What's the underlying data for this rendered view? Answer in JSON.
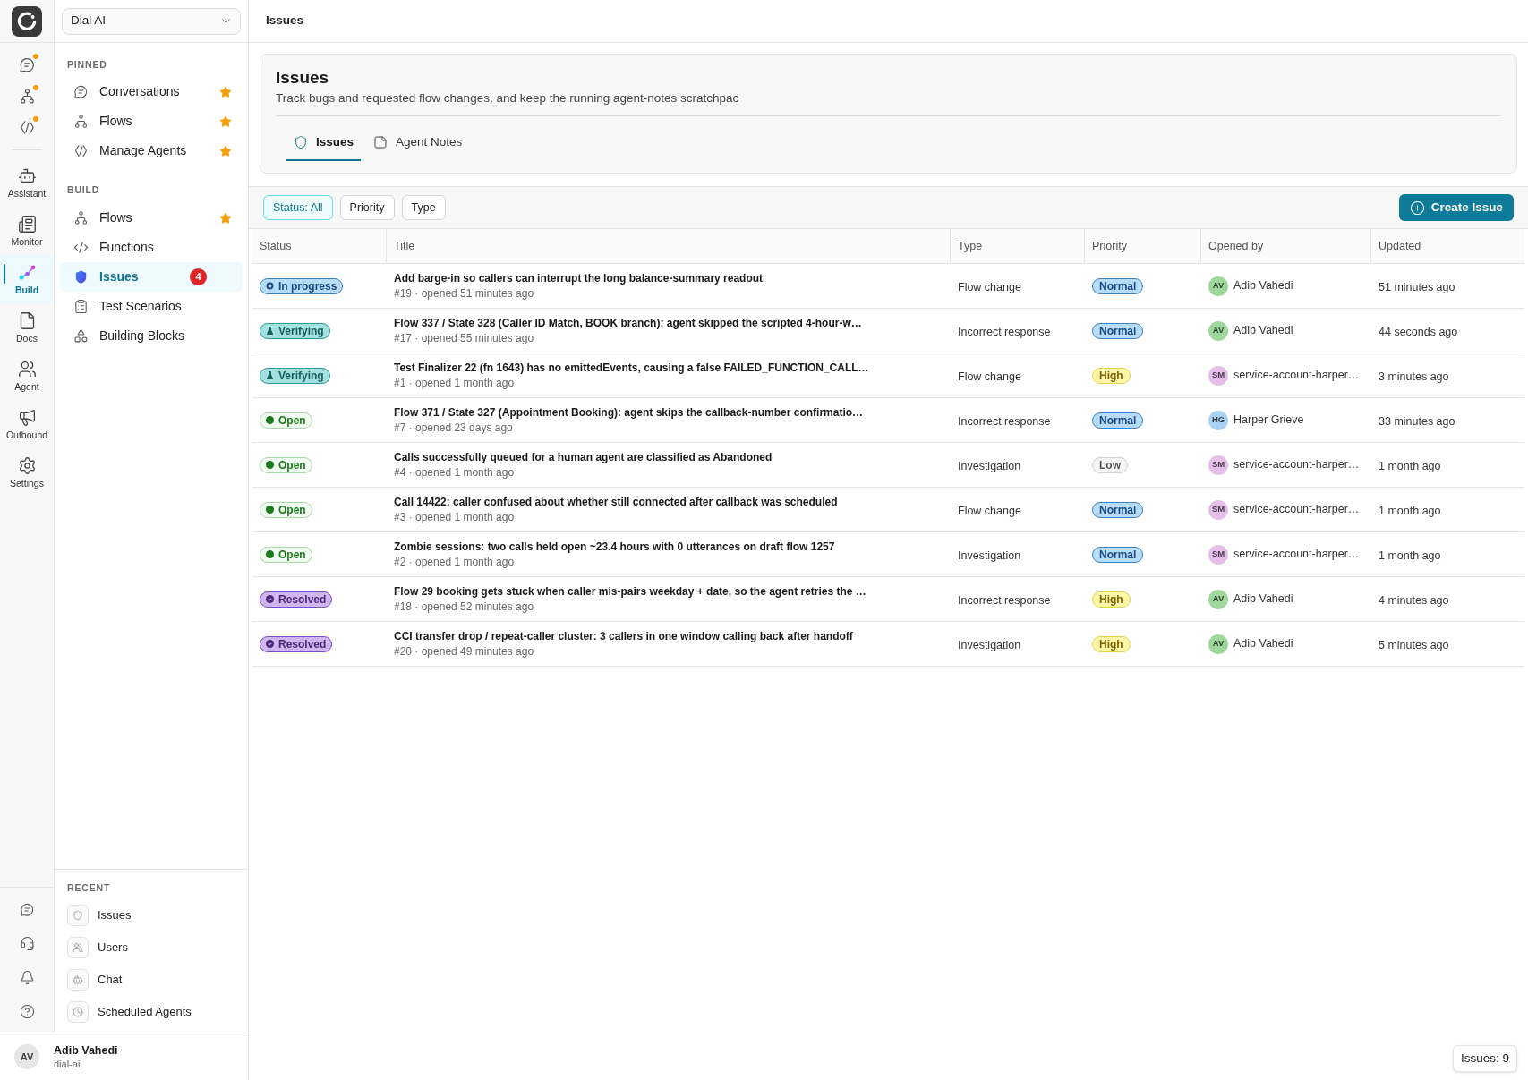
{
  "rail": {
    "top_items": [
      {
        "dot": true
      },
      {
        "dot": true
      },
      {
        "dot": true
      }
    ],
    "items": [
      {
        "label": "Assistant",
        "selected": false
      },
      {
        "label": "Monitor",
        "selected": false
      },
      {
        "label": "Build",
        "selected": true
      },
      {
        "label": "Docs",
        "selected": false
      },
      {
        "label": "Agent",
        "selected": false
      },
      {
        "label": "Outbound",
        "selected": false
      },
      {
        "label": "Settings",
        "selected": false
      }
    ]
  },
  "sidebar": {
    "workspace": "Dial AI",
    "pinned": {
      "heading": "PINNED",
      "items": [
        {
          "label": "Conversations",
          "starred": true
        },
        {
          "label": "Flows",
          "starred": true
        },
        {
          "label": "Manage Agents",
          "starred": true
        }
      ]
    },
    "build": {
      "heading": "BUILD",
      "items": [
        {
          "label": "Flows",
          "starred": true,
          "selected": false
        },
        {
          "label": "Functions",
          "starred": false,
          "selected": false
        },
        {
          "label": "Issues",
          "starred": false,
          "selected": true,
          "badge": "4"
        },
        {
          "label": "Test Scenarios",
          "starred": false,
          "selected": false
        },
        {
          "label": "Building Blocks",
          "starred": false,
          "selected": false
        }
      ]
    },
    "recent": {
      "heading": "RECENT",
      "items": [
        {
          "label": "Issues"
        },
        {
          "label": "Users"
        },
        {
          "label": "Chat"
        },
        {
          "label": "Scheduled Agents"
        }
      ]
    },
    "user": {
      "initials": "AV",
      "name": "Adib Vahedi",
      "org": "dial-ai"
    }
  },
  "topbar": {
    "title": "Issues"
  },
  "header": {
    "title": "Issues",
    "description": "Track bugs and requested flow changes, and keep the running agent-notes scratchpac",
    "tabs": [
      {
        "label": "Issues",
        "selected": true
      },
      {
        "label": "Agent Notes",
        "selected": false
      }
    ]
  },
  "toolbar": {
    "filters": [
      {
        "label": "Status: All",
        "active": true
      },
      {
        "label": "Priority",
        "active": false
      },
      {
        "label": "Type",
        "active": false
      }
    ],
    "create_button": "Create Issue"
  },
  "table": {
    "columns": [
      "Status",
      "Title",
      "Type",
      "Priority",
      "Opened by",
      "Updated"
    ],
    "rows": [
      {
        "status": {
          "label": "In progress",
          "kind": "progress"
        },
        "title": "Add barge-in so callers can interrupt the long balance-summary readout",
        "meta": "#19 · opened 51 minutes ago",
        "type": "Flow change",
        "priority": {
          "label": "Normal",
          "kind": "normal"
        },
        "opened_by": {
          "initials": "AV",
          "name": "Adib Vahedi",
          "color": "#9fd89c"
        },
        "updated": "51 minutes ago"
      },
      {
        "status": {
          "label": "Verifying",
          "kind": "verifying"
        },
        "title": "Flow 337 / State 328 (Caller ID Match, BOOK branch): agent skipped the scripted 4-hour-w…",
        "meta": "#17 · opened 55 minutes ago",
        "type": "Incorrect response",
        "priority": {
          "label": "Normal",
          "kind": "normal"
        },
        "opened_by": {
          "initials": "AV",
          "name": "Adib Vahedi",
          "color": "#9fd89c"
        },
        "updated": "44 seconds ago"
      },
      {
        "status": {
          "label": "Verifying",
          "kind": "verifying"
        },
        "title": "Test Finalizer 22 (fn 1643) has no emittedEvents, causing a false FAILED_FUNCTION_CALL…",
        "meta": "#1 · opened 1 month ago",
        "type": "Flow change",
        "priority": {
          "label": "High",
          "kind": "high"
        },
        "opened_by": {
          "initials": "SM",
          "name": "service-account-harper…",
          "color": "#e5bfea"
        },
        "updated": "3 minutes ago"
      },
      {
        "status": {
          "label": "Open",
          "kind": "open"
        },
        "title": "Flow 371 / State 327 (Appointment Booking): agent skips the callback-number confirmatio…",
        "meta": "#7 · opened 23 days ago",
        "type": "Incorrect response",
        "priority": {
          "label": "Normal",
          "kind": "normal"
        },
        "opened_by": {
          "initials": "HG",
          "name": "Harper Grieve",
          "color": "#a8d3f3"
        },
        "updated": "33 minutes ago"
      },
      {
        "status": {
          "label": "Open",
          "kind": "open"
        },
        "title": "Calls successfully queued for a human agent are classified as Abandoned",
        "meta": "#4 · opened 1 month ago",
        "type": "Investigation",
        "priority": {
          "label": "Low",
          "kind": "low"
        },
        "opened_by": {
          "initials": "SM",
          "name": "service-account-harper…",
          "color": "#e5bfea"
        },
        "updated": "1 month ago"
      },
      {
        "status": {
          "label": "Open",
          "kind": "open"
        },
        "title": "Call 14422: caller confused about whether still connected after callback was scheduled",
        "meta": "#3 · opened 1 month ago",
        "type": "Flow change",
        "priority": {
          "label": "Normal",
          "kind": "normal"
        },
        "opened_by": {
          "initials": "SM",
          "name": "service-account-harper…",
          "color": "#e5bfea"
        },
        "updated": "1 month ago"
      },
      {
        "status": {
          "label": "Open",
          "kind": "open"
        },
        "title": "Zombie sessions: two calls held open ~23.4 hours with 0 utterances on draft flow 1257",
        "meta": "#2 · opened 1 month ago",
        "type": "Investigation",
        "priority": {
          "label": "Normal",
          "kind": "normal"
        },
        "opened_by": {
          "initials": "SM",
          "name": "service-account-harper…",
          "color": "#e5bfea"
        },
        "updated": "1 month ago"
      },
      {
        "status": {
          "label": "Resolved",
          "kind": "resolved"
        },
        "title": "Flow 29 booking gets stuck when caller mis-pairs weekday + date, so the agent retries the …",
        "meta": "#18 · opened 52 minutes ago",
        "type": "Incorrect response",
        "priority": {
          "label": "High",
          "kind": "high"
        },
        "opened_by": {
          "initials": "AV",
          "name": "Adib Vahedi",
          "color": "#9fd89c"
        },
        "updated": "4 minutes ago"
      },
      {
        "status": {
          "label": "Resolved",
          "kind": "resolved"
        },
        "title": "CCI transfer drop / repeat-caller cluster: 3 callers in one window calling back after handoff",
        "meta": "#20 · opened 49 minutes ago",
        "type": "Investigation",
        "priority": {
          "label": "High",
          "kind": "high"
        },
        "opened_by": {
          "initials": "AV",
          "name": "Adib Vahedi",
          "color": "#9fd89c"
        },
        "updated": "5 minutes ago"
      }
    ]
  },
  "count_chip": "Issues: 9"
}
